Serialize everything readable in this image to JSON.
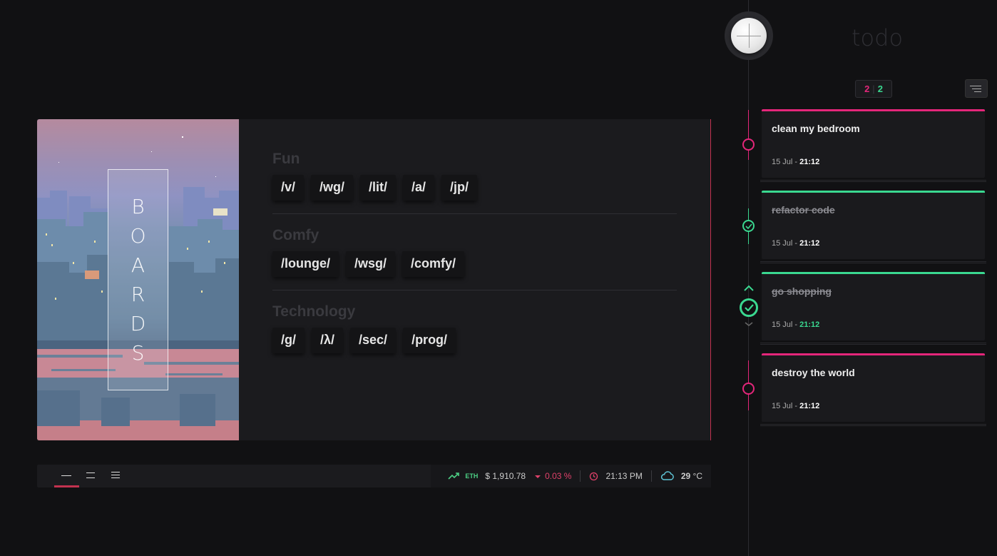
{
  "colors": {
    "accent_pink": "#e4267a",
    "accent_green": "#3ad890",
    "card_accent": "#c2324f",
    "background": "#111113"
  },
  "hero": {
    "letters": [
      "B",
      "O",
      "A",
      "R",
      "D",
      "S"
    ]
  },
  "groups": [
    {
      "title": "Fun",
      "links": [
        "/v/",
        "/wg/",
        "/lit/",
        "/a/",
        "/jp/"
      ]
    },
    {
      "title": "Comfy",
      "links": [
        "/lounge/",
        "/wsg/",
        "/comfy/"
      ]
    },
    {
      "title": "Technology",
      "links": [
        "/g/",
        "/λ/",
        "/sec/",
        "/prog/"
      ]
    }
  ],
  "footer": {
    "views": [
      "single-line-view",
      "double-line-view",
      "triple-line-view"
    ],
    "ticker": "ETH",
    "price": "$ 1,910.78",
    "change": "0.03 %",
    "time": "21:13 PM",
    "temperature": "29",
    "temperature_unit": "°C",
    "icons": [
      "trend-up-icon",
      "caret-down-icon",
      "clock-icon",
      "cloud-icon"
    ]
  },
  "todo": {
    "title": "todo",
    "counter_pending": "2",
    "counter_done": "2",
    "items": [
      {
        "name": "clean my bedroom",
        "date": "15 Jul - ",
        "time": "21:12",
        "done": false
      },
      {
        "name": "refactor code",
        "date": "15 Jul - ",
        "time": "21:12",
        "done": true
      },
      {
        "name": "go shopping",
        "date": "15 Jul - ",
        "time": "21:12",
        "done": true
      },
      {
        "name": "destroy the world",
        "date": "15 Jul - ",
        "time": "21:12",
        "done": false
      }
    ]
  }
}
